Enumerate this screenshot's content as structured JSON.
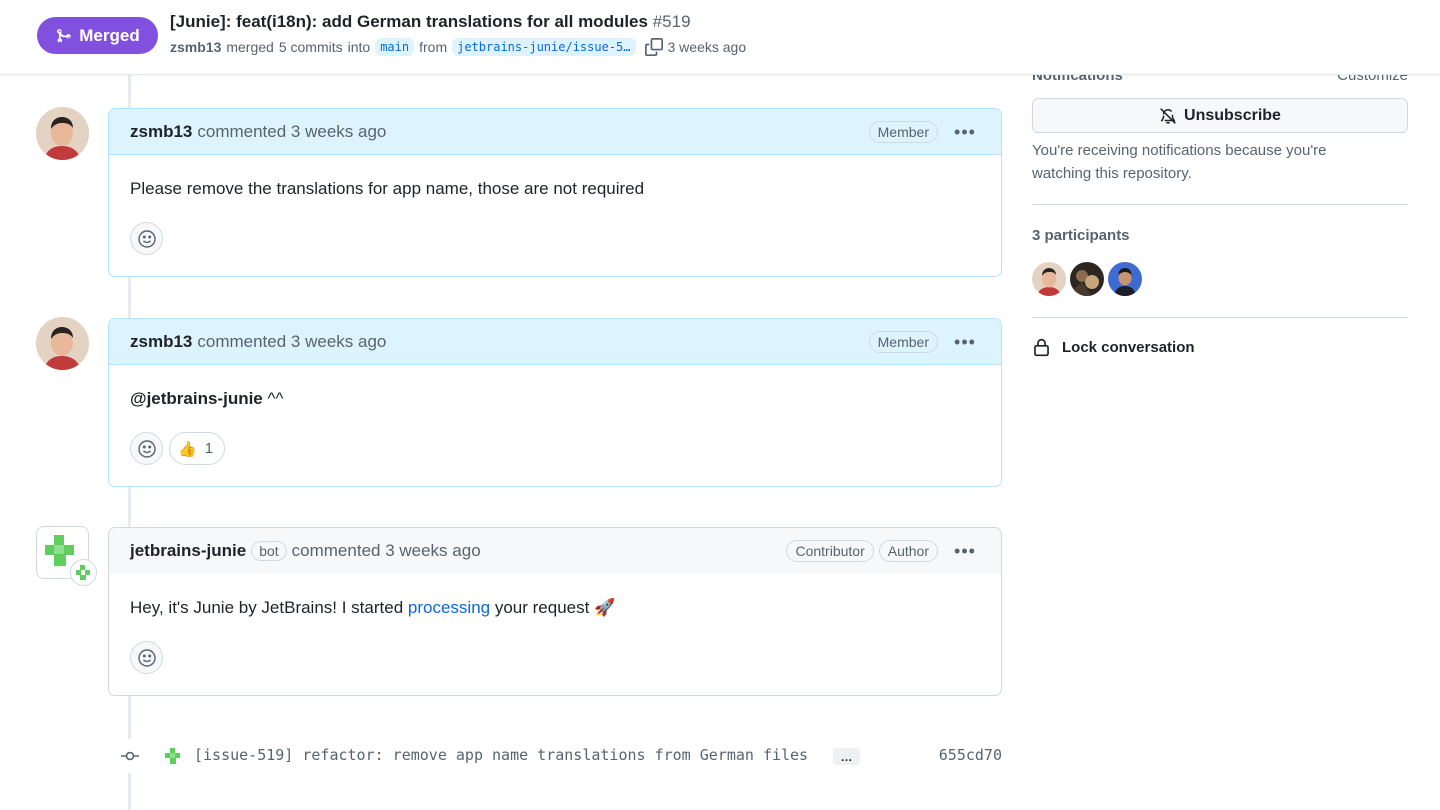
{
  "header": {
    "status": "Merged",
    "title": "[Junie]: feat(i18n): add German translations for all modules",
    "number": "#519",
    "author": "zsmb13",
    "merged_text": "merged",
    "commits": "5 commits",
    "into_text": "into",
    "base_branch": "main",
    "from_text": "from",
    "head_branch": "jetbrains-junie/issue-5…",
    "time": "3 weeks ago"
  },
  "comments": [
    {
      "author": "zsmb13",
      "meta": "commented 3 weeks ago",
      "labels": [
        "Member"
      ],
      "body": "Please remove the translations for app name, those are not required"
    },
    {
      "author": "zsmb13",
      "meta": "commented 3 weeks ago",
      "labels": [
        "Member"
      ],
      "body_mention": "@jetbrains-junie",
      "body_rest": " ^^",
      "reaction": {
        "emoji": "👍",
        "count": "1"
      }
    },
    {
      "author": "jetbrains-junie",
      "bot_tag": "bot",
      "meta": "commented 3 weeks ago",
      "labels": [
        "Contributor",
        "Author"
      ],
      "body_before": "Hey, it's Junie by JetBrains! I started ",
      "body_link": "processing",
      "body_after": " your request 🚀"
    }
  ],
  "commit": {
    "message": "[issue-519] refactor: remove app name translations from German files",
    "more": "…",
    "sha": "655cd70"
  },
  "sidebar": {
    "notifications_label": "Notifications",
    "customize": "Customize",
    "unsubscribe": "Unsubscribe",
    "notif_text": "You're receiving notifications because you're watching this repository.",
    "participants_label": "3 participants",
    "lock": "Lock conversation"
  },
  "colors": {
    "merged": "#8250df",
    "comment_header": "#ddf4ff",
    "link": "#0969da",
    "junie_green": "#5fce5f"
  }
}
